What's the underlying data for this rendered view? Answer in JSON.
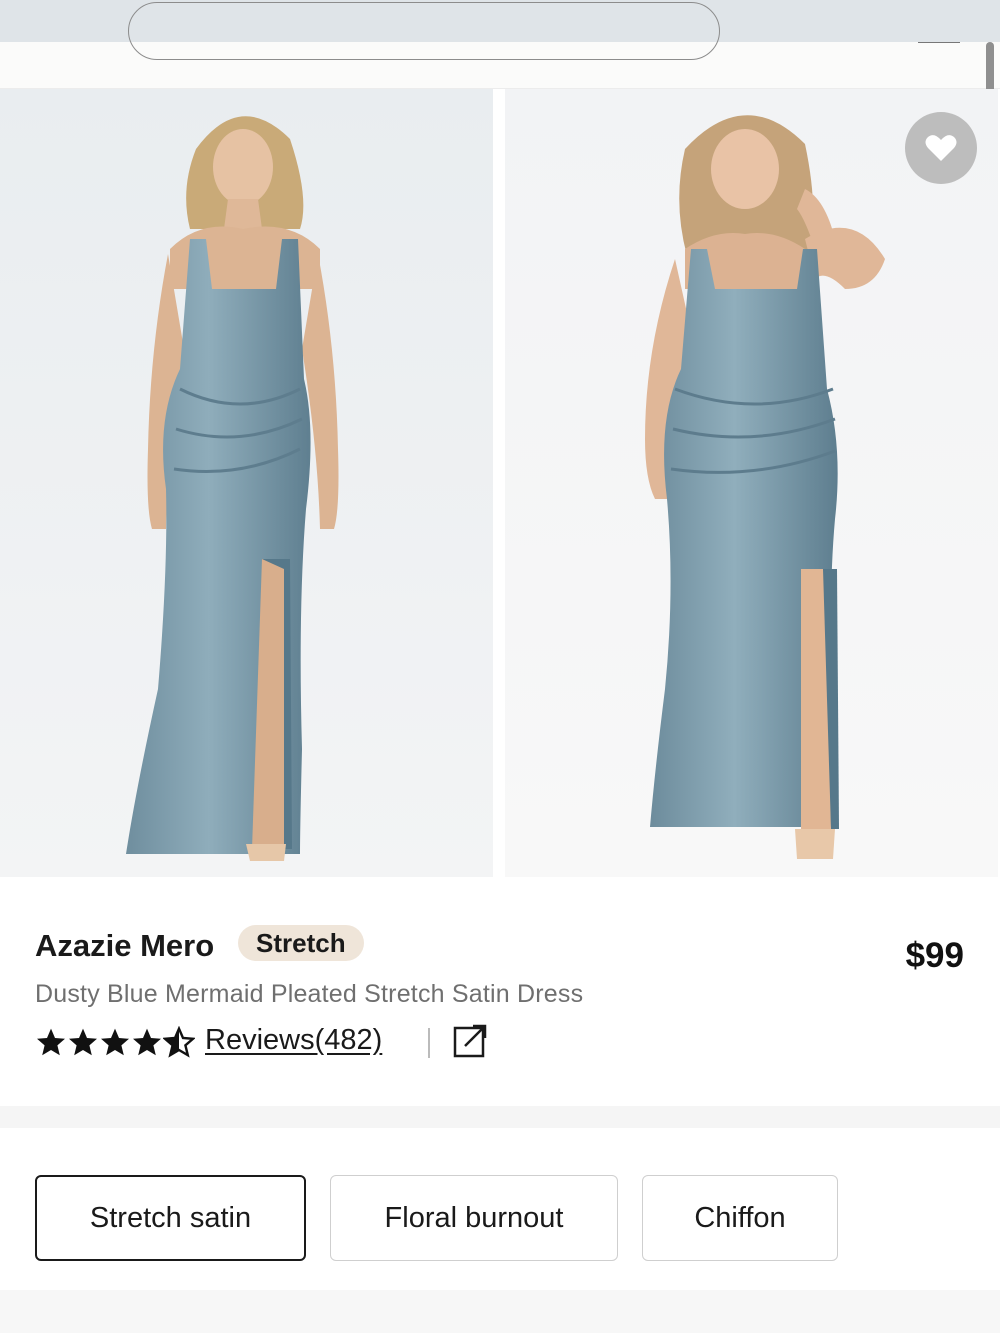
{
  "header": {
    "search_placeholder": ""
  },
  "gallery": {
    "image_left": {
      "alt": "Model in dusty blue dress, front view"
    },
    "image_right": {
      "alt": "Model in dusty blue dress, alternate model"
    },
    "favorite_icon": "heart-icon"
  },
  "product": {
    "brand": "Azazie Mero",
    "badge": "Stretch",
    "price": "$99",
    "name": "Dusty Blue Mermaid Pleated Stretch Satin Dress",
    "rating": 4.5,
    "rating_max": 5,
    "reviews_label": "Reviews(482)",
    "share_icon": "external-link-icon"
  },
  "fabrics": {
    "options": [
      "Stretch satin",
      "Floral burnout",
      "Chiffon"
    ],
    "selected": "Stretch satin"
  },
  "colors": {
    "dress": "#7e9cab",
    "badge_bg": "#efe5d9",
    "fav_bg": "#bdbdbd"
  }
}
